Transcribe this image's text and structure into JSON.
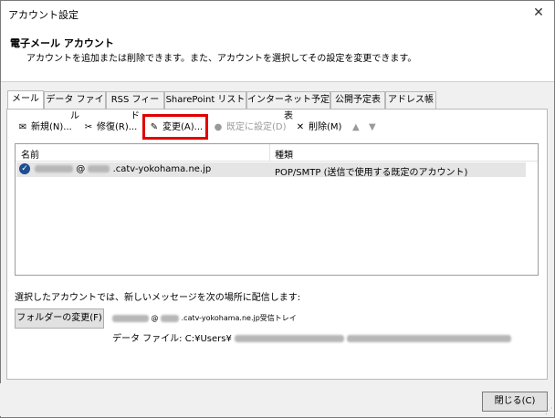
{
  "window": {
    "title": "アカウント設定",
    "close_glyph": "✕"
  },
  "header": {
    "title": "電子メール アカウント",
    "description": "アカウントを追加または削除できます。また、アカウントを選択してその設定を変更できます。"
  },
  "tabs": [
    {
      "label": "メール",
      "active": true
    },
    {
      "label": "データ ファイル"
    },
    {
      "label": "RSS フィード"
    },
    {
      "label": "SharePoint リスト"
    },
    {
      "label": "インターネット予定表"
    },
    {
      "label": "公開予定表"
    },
    {
      "label": "アドレス帳"
    }
  ],
  "toolbar": {
    "new": "新規(N)...",
    "repair": "修復(R)...",
    "change": "変更(A)...",
    "set_default": "既定に設定(D)",
    "delete": "削除(M)",
    "move_up_icon": "arrow-up-icon",
    "move_down_icon": "arrow-down-icon"
  },
  "list": {
    "col_name": "名前",
    "col_type": "種類",
    "rows": [
      {
        "account_suffix": ".catv-yokohama.ne.jp",
        "at": "@",
        "type": "POP/SMTP (送信で使用する既定のアカウント)"
      }
    ]
  },
  "delivery": {
    "text": "選択したアカウントでは、新しいメッセージを次の場所に配信します:",
    "folder_button": "フォルダーの変更(F)",
    "target_suffix": ".catv-yokohama.ne.jp受信トレイ",
    "at": "@",
    "datafile_label": "データ ファイル: C:¥Users¥"
  },
  "footer": {
    "close_button": "閉じる(C)"
  }
}
